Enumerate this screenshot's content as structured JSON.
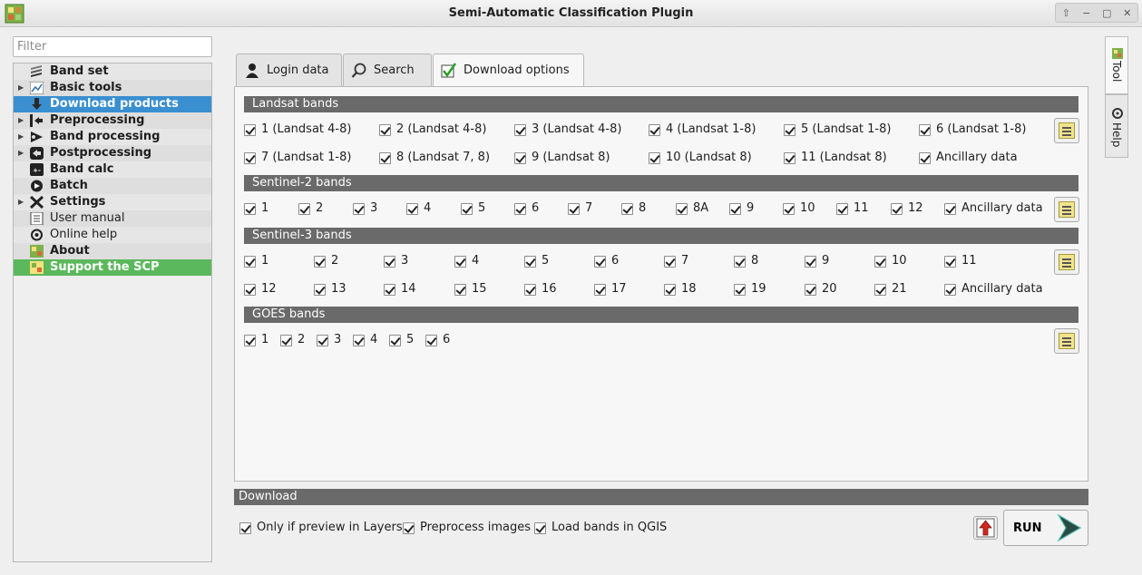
{
  "window": {
    "title": "Semi-Automatic Classification Plugin",
    "controls": [
      "⇧",
      "−",
      "▢",
      "✕"
    ]
  },
  "filter": {
    "placeholder": "Filter",
    "value": ""
  },
  "tree": [
    {
      "label": "Band set",
      "bold": true,
      "expandable": false,
      "icon": "band-set-icon"
    },
    {
      "label": "Basic tools",
      "bold": true,
      "expandable": true,
      "icon": "basic-tools-icon"
    },
    {
      "label": "Download products",
      "bold": true,
      "expandable": false,
      "selected": true,
      "icon": "download-icon"
    },
    {
      "label": "Preprocessing",
      "bold": true,
      "expandable": true,
      "icon": "preprocessing-icon"
    },
    {
      "label": "Band processing",
      "bold": true,
      "expandable": true,
      "icon": "band-processing-icon"
    },
    {
      "label": "Postprocessing",
      "bold": true,
      "expandable": true,
      "icon": "postprocessing-icon"
    },
    {
      "label": "Band calc",
      "bold": true,
      "expandable": false,
      "icon": "band-calc-icon"
    },
    {
      "label": "Batch",
      "bold": true,
      "expandable": false,
      "icon": "batch-icon"
    },
    {
      "label": "Settings",
      "bold": true,
      "expandable": true,
      "icon": "settings-icon"
    },
    {
      "label": "User manual",
      "bold": false,
      "expandable": false,
      "icon": "user-manual-icon"
    },
    {
      "label": "Online help",
      "bold": false,
      "expandable": false,
      "icon": "online-help-icon"
    },
    {
      "label": "About",
      "bold": true,
      "expandable": false,
      "icon": "about-icon"
    },
    {
      "label": "Support the SCP",
      "bold": true,
      "expandable": false,
      "green": true,
      "icon": "support-icon"
    }
  ],
  "tabs": [
    {
      "label": "Login data",
      "icon": "user-icon",
      "active": false
    },
    {
      "label": "Search",
      "icon": "search-icon",
      "active": false
    },
    {
      "label": "Download options",
      "icon": "checkmark-icon",
      "active": true
    }
  ],
  "sections": {
    "landsat": {
      "title": "Landsat bands",
      "row1": [
        "1 (Landsat 4-8)",
        "2 (Landsat 4-8)",
        "3 (Landsat 4-8)",
        "4 (Landsat 1-8)",
        "5 (Landsat 1-8)",
        "6 (Landsat 1-8)"
      ],
      "row2": [
        "7 (Landsat 1-8)",
        "8 (Landsat 7, 8)",
        "9 (Landsat 8)",
        "10 (Landsat 8)",
        "11 (Landsat 8)",
        "Ancillary data"
      ]
    },
    "sentinel2": {
      "title": "Sentinel-2 bands",
      "row1": [
        "1",
        "2",
        "3",
        "4",
        "5",
        "6",
        "7",
        "8",
        "8A",
        "9",
        "10",
        "11",
        "12",
        "Ancillary data"
      ]
    },
    "sentinel3": {
      "title": "Sentinel-3 bands",
      "row1": [
        "1",
        "2",
        "3",
        "4",
        "5",
        "6",
        "7",
        "8",
        "9",
        "10",
        "11"
      ],
      "row2": [
        "12",
        "13",
        "14",
        "15",
        "16",
        "17",
        "18",
        "19",
        "20",
        "21",
        "Ancillary data"
      ]
    },
    "goes": {
      "title": "GOES bands",
      "row1": [
        "1",
        "2",
        "3",
        "4",
        "5",
        "6"
      ]
    }
  },
  "download": {
    "title": "Download",
    "options": [
      "Only if preview in Layers",
      "Preprocess images",
      "Load bands in QGIS"
    ],
    "run_label": "RUN"
  },
  "dock": {
    "tool_label": "Tool",
    "help_label": "Help"
  }
}
